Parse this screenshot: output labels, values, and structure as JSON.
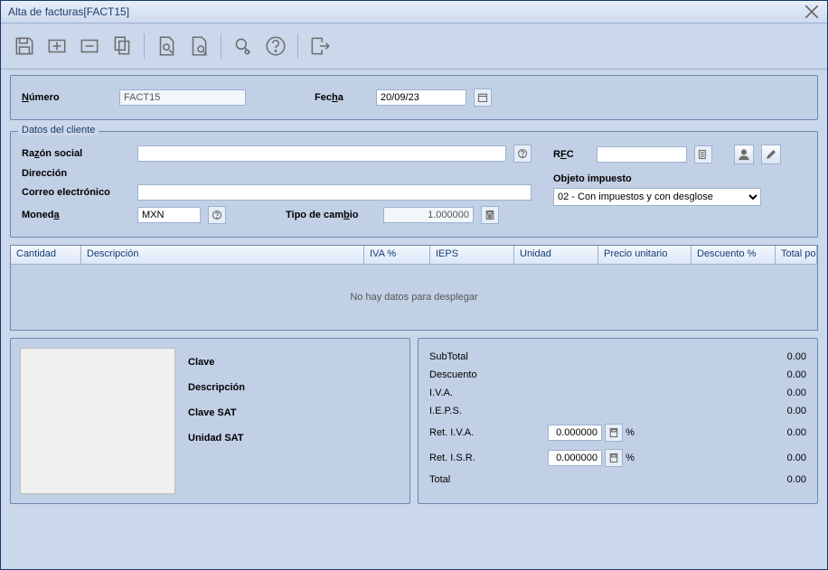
{
  "window": {
    "title": "Alta de facturas[FACT15]"
  },
  "header": {
    "numero_label": "Número",
    "numero_value": "FACT15",
    "fecha_label": "Fecha",
    "fecha_value": "20/09/23"
  },
  "cliente": {
    "legend": "Datos del cliente",
    "razon_label": "Razón social",
    "razon_value": "",
    "direccion_label": "Dirección",
    "correo_label": "Correo electrónico",
    "correo_value": "",
    "moneda_label": "Moneda",
    "moneda_value": "MXN",
    "tipo_cambio_label": "Tipo de cambio",
    "tipo_cambio_value": "1.000000",
    "rfc_label": "RFC",
    "rfc_value": "",
    "objeto_label": "Objeto impuesto",
    "objeto_value": "02 - Con impuestos y con desglose"
  },
  "grid": {
    "cols": {
      "cantidad": "Cantidad",
      "descripcion": "Descripción",
      "iva": "IVA %",
      "ieps": "IEPS",
      "unidad": "Unidad",
      "precio": "Precio unitario",
      "descuento": "Descuento %",
      "total": "Total por partida"
    },
    "empty": "No hay datos para desplegar"
  },
  "detail": {
    "clave": "Clave",
    "descripcion": "Descripción",
    "clave_sat": "Clave SAT",
    "unidad_sat": "Unidad SAT"
  },
  "totals": {
    "subtotal_label": "SubTotal",
    "subtotal": "0.00",
    "descuento_label": "Descuento",
    "descuento": "0.00",
    "iva_label": "I.V.A.",
    "iva": "0.00",
    "ieps_label": "I.E.P.S.",
    "ieps": "0.00",
    "ret_iva_label": "Ret. I.V.A.",
    "ret_iva_in": "0.000000",
    "pct": "%",
    "ret_iva": "0.00",
    "ret_isr_label": "Ret. I.S.R.",
    "ret_isr_in": "0.000000",
    "ret_isr": "0.00",
    "total_label": "Total",
    "total": "0.00"
  }
}
